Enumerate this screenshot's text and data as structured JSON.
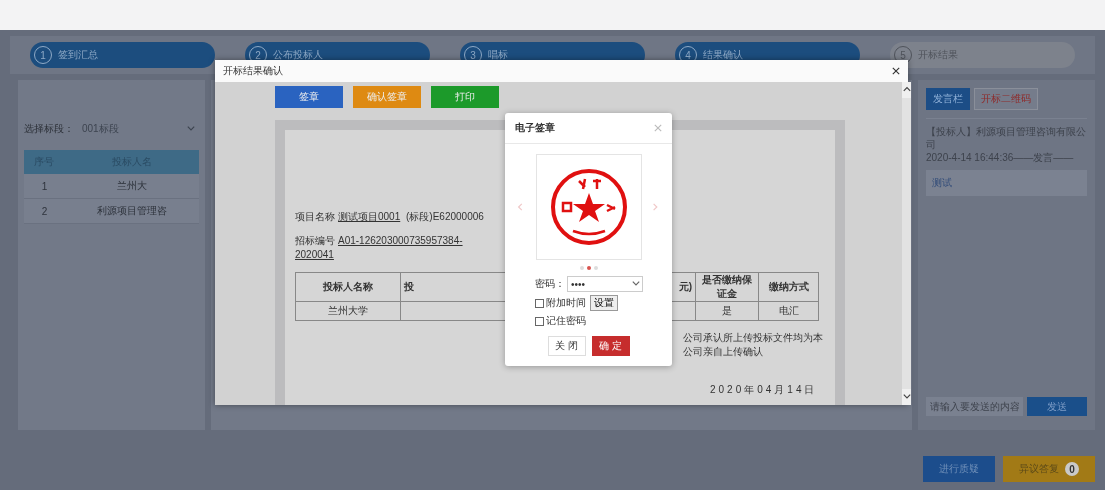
{
  "steps": [
    {
      "number": "1",
      "label": "签到汇总",
      "done": true
    },
    {
      "number": "2",
      "label": "公布投标人",
      "done": true
    },
    {
      "number": "3",
      "label": "唱标",
      "done": true
    },
    {
      "number": "4",
      "label": "结果确认",
      "done": true
    },
    {
      "number": "5",
      "label": "开标结果",
      "done": false
    }
  ],
  "left_panel": {
    "section_label": "选择标段：",
    "section_select": "001标段",
    "table": {
      "columns": [
        "序号",
        "投标人名"
      ],
      "rows": [
        [
          "1",
          "兰州大"
        ],
        [
          "2",
          "利源项目管理咨"
        ]
      ]
    }
  },
  "dialog": {
    "title": "开标结果确认",
    "actions": [
      {
        "label": "签章",
        "kind": "primary"
      },
      {
        "label": "确认签章",
        "kind": "warning"
      },
      {
        "label": "打印",
        "kind": "success"
      }
    ],
    "document": {
      "project_label": "项目名称",
      "project_value": "测试项目0001",
      "segment": "(标段)E62000006",
      "tender_label": "招标编号",
      "tender_value": "A01-126203000735957384-2020041",
      "table": {
        "columns": [
          "投标人名称",
          "投",
          "元)",
          "是否缴纳保证金",
          "缴纳方式"
        ],
        "rows": [
          {
            "column_1": "兰州大学",
            "column_4": "是",
            "column_5": "电汇"
          }
        ]
      },
      "statement": "公司承认所上传投标文件均为本公司亲自上传确认",
      "date": "2020年04月14日"
    }
  },
  "signature_dialog": {
    "title": "电子签章",
    "slides": [
      {
        "selected": false
      },
      {
        "selected": true
      },
      {
        "selected": false
      }
    ],
    "password_label": "密码：",
    "password_value": "••••",
    "options": [
      {
        "label": "附加时间",
        "checked": false,
        "button": "设置"
      },
      {
        "label": "记住密码",
        "checked": false
      }
    ],
    "buttons": [
      {
        "label": "关 闭",
        "kind": "default"
      },
      {
        "label": "确 定",
        "kind": "danger"
      }
    ]
  },
  "chat": {
    "tabs": [
      {
        "label": "发言栏",
        "selected": true
      },
      {
        "label": "开标二维码",
        "selected": false
      }
    ],
    "messages": [
      {
        "sender": "【投标人】利源项目管理咨询有限公司",
        "meta": "2020-4-14 16:44:36——发言——",
        "text": "测试"
      }
    ],
    "input_placeholder": "请输入要发送的内容",
    "send": "发送"
  },
  "footer_buttons": [
    {
      "label": "进行质疑",
      "kind": "primary"
    },
    {
      "label": "异议答复",
      "kind": "warning",
      "badge": "0"
    }
  ]
}
